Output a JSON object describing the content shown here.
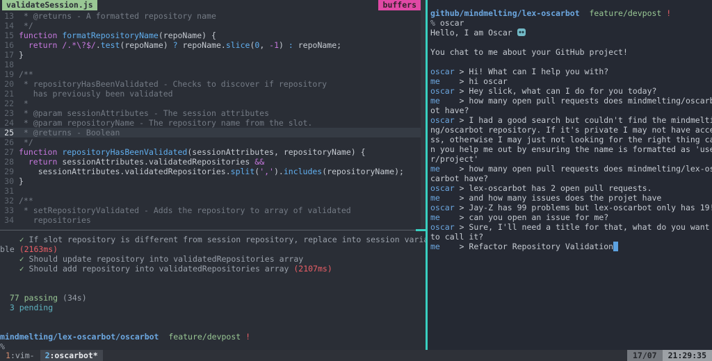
{
  "tabline": {
    "file_tab": "validateSession.js",
    "buffers_label": "buffers"
  },
  "editor": {
    "lines": [
      {
        "num": 13,
        "seg": [
          [
            "c",
            " * @returns - A formatted repository name"
          ]
        ]
      },
      {
        "num": 14,
        "seg": [
          [
            "c",
            " */"
          ]
        ]
      },
      {
        "num": 15,
        "seg": [
          [
            "k",
            "function"
          ],
          [
            "t",
            " "
          ],
          [
            "f",
            "formatRepositoryName"
          ],
          [
            "t",
            "(repoName) {"
          ]
        ]
      },
      {
        "num": 16,
        "seg": [
          [
            "t",
            "  "
          ],
          [
            "k",
            "return"
          ],
          [
            "t",
            " "
          ],
          [
            "k",
            "/.*\\?$/"
          ],
          [
            "t",
            "."
          ],
          [
            "f",
            "test"
          ],
          [
            "t",
            "(repoName) "
          ],
          [
            "o",
            "?"
          ],
          [
            "t",
            " repoName."
          ],
          [
            "f",
            "slice"
          ],
          [
            "t",
            "("
          ],
          [
            "n",
            "0"
          ],
          [
            "t",
            ", "
          ],
          [
            "k",
            "-1"
          ],
          [
            "t",
            ") "
          ],
          [
            "o",
            ":"
          ],
          [
            "t",
            " repoName;"
          ]
        ]
      },
      {
        "num": 17,
        "seg": [
          [
            "t",
            "}"
          ]
        ]
      },
      {
        "num": 18,
        "seg": []
      },
      {
        "num": 19,
        "seg": [
          [
            "c",
            "/**"
          ]
        ]
      },
      {
        "num": 20,
        "seg": [
          [
            "c",
            " * repositoryHasBeenValidated - Checks to discover if repository"
          ]
        ]
      },
      {
        "num": 21,
        "seg": [
          [
            "c",
            "   has previously been validated"
          ]
        ]
      },
      {
        "num": 22,
        "seg": [
          [
            "c",
            " *"
          ]
        ]
      },
      {
        "num": 23,
        "seg": [
          [
            "c",
            " * @param sessionAttributes - The session attributes"
          ]
        ]
      },
      {
        "num": 24,
        "seg": [
          [
            "c",
            " * @param repositoryName - The repository name from the slot."
          ]
        ]
      },
      {
        "num": 25,
        "cur": true,
        "seg": [
          [
            "c",
            " * @returns - Boolean"
          ]
        ]
      },
      {
        "num": 26,
        "seg": [
          [
            "c",
            " */"
          ]
        ]
      },
      {
        "num": 27,
        "seg": [
          [
            "k",
            "function"
          ],
          [
            "t",
            " "
          ],
          [
            "f",
            "repositoryHasBeenValidated"
          ],
          [
            "t",
            "(sessionAttributes, repositoryName) {"
          ]
        ]
      },
      {
        "num": 28,
        "seg": [
          [
            "t",
            "  "
          ],
          [
            "k",
            "return"
          ],
          [
            "t",
            " sessionAttributes.validatedRepositories "
          ],
          [
            "k",
            "&&"
          ]
        ]
      },
      {
        "num": 29,
        "seg": [
          [
            "t",
            "    sessionAttributes.validatedRepositories."
          ],
          [
            "f",
            "split"
          ],
          [
            "t",
            "("
          ],
          [
            "s",
            "','"
          ],
          [
            "t",
            ")."
          ],
          [
            "f",
            "includes"
          ],
          [
            "t",
            "(repositoryName);"
          ]
        ]
      },
      {
        "num": 30,
        "seg": [
          [
            "t",
            "}"
          ]
        ]
      },
      {
        "num": 31,
        "seg": []
      },
      {
        "num": 32,
        "seg": [
          [
            "c",
            "/**"
          ]
        ]
      },
      {
        "num": 33,
        "seg": [
          [
            "c",
            " * setRepositoryValidated - Adds the repository to array of validated"
          ]
        ]
      },
      {
        "num": 34,
        "seg": [
          [
            "c",
            "   repositories"
          ]
        ]
      }
    ]
  },
  "tests": {
    "rows": [
      {
        "seg": [
          [
            "g",
            "    ✓ "
          ],
          [
            "d",
            "If slot repository is different from session repository, replace into session varia"
          ]
        ]
      },
      {
        "seg": [
          [
            "d",
            "ble "
          ],
          [
            "r",
            "(2163ms)"
          ]
        ]
      },
      {
        "seg": [
          [
            "g",
            "    ✓ "
          ],
          [
            "d",
            "Should update repository into validatedRepositories array"
          ]
        ]
      },
      {
        "seg": [
          [
            "g",
            "    ✓ "
          ],
          [
            "d",
            "Should add repository into validatedRepositories array "
          ],
          [
            "r",
            "(2107ms)"
          ]
        ]
      },
      {
        "seg": []
      },
      {
        "seg": []
      },
      {
        "seg": [
          [
            "g",
            "  77 passing"
          ],
          [
            "d",
            " (34s)"
          ]
        ]
      },
      {
        "seg": [
          [
            "cy",
            "  3 pending"
          ]
        ]
      },
      {
        "seg": []
      },
      {
        "seg": []
      },
      {
        "seg": [
          [
            "pathb",
            "mindmelting/lex-oscarbot/oscarbot"
          ],
          [
            "t",
            "  "
          ],
          [
            "g",
            "feature/devpost"
          ],
          [
            "r",
            " !"
          ]
        ]
      },
      {
        "seg": [
          [
            "d",
            "%"
          ]
        ]
      }
    ]
  },
  "chat": {
    "rows": [
      {
        "seg": [
          [
            "pathb",
            "github/mindmelting/lex-oscarbot"
          ],
          [
            "t",
            "  "
          ],
          [
            "g",
            "feature/devpost"
          ],
          [
            "r",
            " !"
          ]
        ]
      },
      {
        "seg": [
          [
            "d",
            "% "
          ],
          [
            "t",
            "oscar"
          ]
        ]
      },
      {
        "seg": [
          [
            "t",
            "Hello, I am Oscar "
          ],
          [
            "robot",
            "🤖"
          ]
        ]
      },
      {
        "seg": []
      },
      {
        "seg": [
          [
            "t",
            "You chat to me about your GitHub project!"
          ]
        ]
      },
      {
        "seg": []
      },
      {
        "seg": [
          [
            "name",
            "oscar"
          ],
          [
            "t",
            " > Hi! What can I help you with?"
          ]
        ]
      },
      {
        "seg": [
          [
            "name",
            "me"
          ],
          [
            "t",
            "    > hi oscar"
          ]
        ]
      },
      {
        "seg": [
          [
            "name",
            "oscar"
          ],
          [
            "t",
            " > Hey slick, what can I do for you today?"
          ]
        ]
      },
      {
        "seg": [
          [
            "name",
            "me"
          ],
          [
            "t",
            "    > how many open pull requests does mindmelting/oscarb"
          ]
        ]
      },
      {
        "seg": [
          [
            "t",
            "ot have?"
          ]
        ]
      },
      {
        "seg": [
          [
            "name",
            "oscar"
          ],
          [
            "t",
            " > I had a good search but couldn't find the mindmelti"
          ]
        ]
      },
      {
        "seg": [
          [
            "t",
            "ng/oscarbot repository. If it's private I may not have acce"
          ]
        ]
      },
      {
        "seg": [
          [
            "t",
            "ss, otherwise I may just not looking for the right thing ca"
          ]
        ]
      },
      {
        "seg": [
          [
            "t",
            "n you help me out by ensuring the name is formatted as 'use"
          ]
        ]
      },
      {
        "seg": [
          [
            "t",
            "r/project'"
          ]
        ]
      },
      {
        "seg": [
          [
            "name",
            "me"
          ],
          [
            "t",
            "    > how many open pull requests does mindmelting/lex-os"
          ]
        ]
      },
      {
        "seg": [
          [
            "t",
            "carbot have?"
          ]
        ]
      },
      {
        "seg": [
          [
            "name",
            "oscar"
          ],
          [
            "t",
            " > lex-oscarbot has 2 open pull requests."
          ]
        ]
      },
      {
        "seg": [
          [
            "name",
            "me"
          ],
          [
            "t",
            "    > and how many issues does the projet have"
          ]
        ]
      },
      {
        "seg": [
          [
            "name",
            "oscar"
          ],
          [
            "t",
            " > Jay-Z has 99 problems but lex-oscarbot only has 19!"
          ]
        ]
      },
      {
        "seg": [
          [
            "name",
            "me"
          ],
          [
            "t",
            "    > can you open an issue for me?"
          ]
        ]
      },
      {
        "seg": [
          [
            "name",
            "oscar"
          ],
          [
            "t",
            " > Sure, I'll need a title for that, what do you want"
          ]
        ]
      },
      {
        "seg": [
          [
            "t",
            "to call it?"
          ]
        ]
      },
      {
        "seg": [
          [
            "name",
            "me"
          ],
          [
            "t",
            "    > Refactor Repository Validation"
          ],
          [
            "cursor",
            " "
          ]
        ]
      }
    ]
  },
  "statusbar": {
    "window1_num": "1",
    "window1_label": ":vim-",
    "window2_num": "2",
    "window2_label": ":oscarbot*",
    "date": "17/07",
    "time": "21:29:35"
  },
  "colors": {
    "pane_divider_teal": "#38cfc0",
    "tab_green": "#99c794",
    "buffers_pink": "#e049a5",
    "error_red": "#ec5f67",
    "keyword_magenta": "#c678dd",
    "function_blue": "#61afef",
    "chat_name_blue": "#6ca7e0",
    "pending_cyan": "#5fb3c0",
    "success_green": "#99c794"
  }
}
